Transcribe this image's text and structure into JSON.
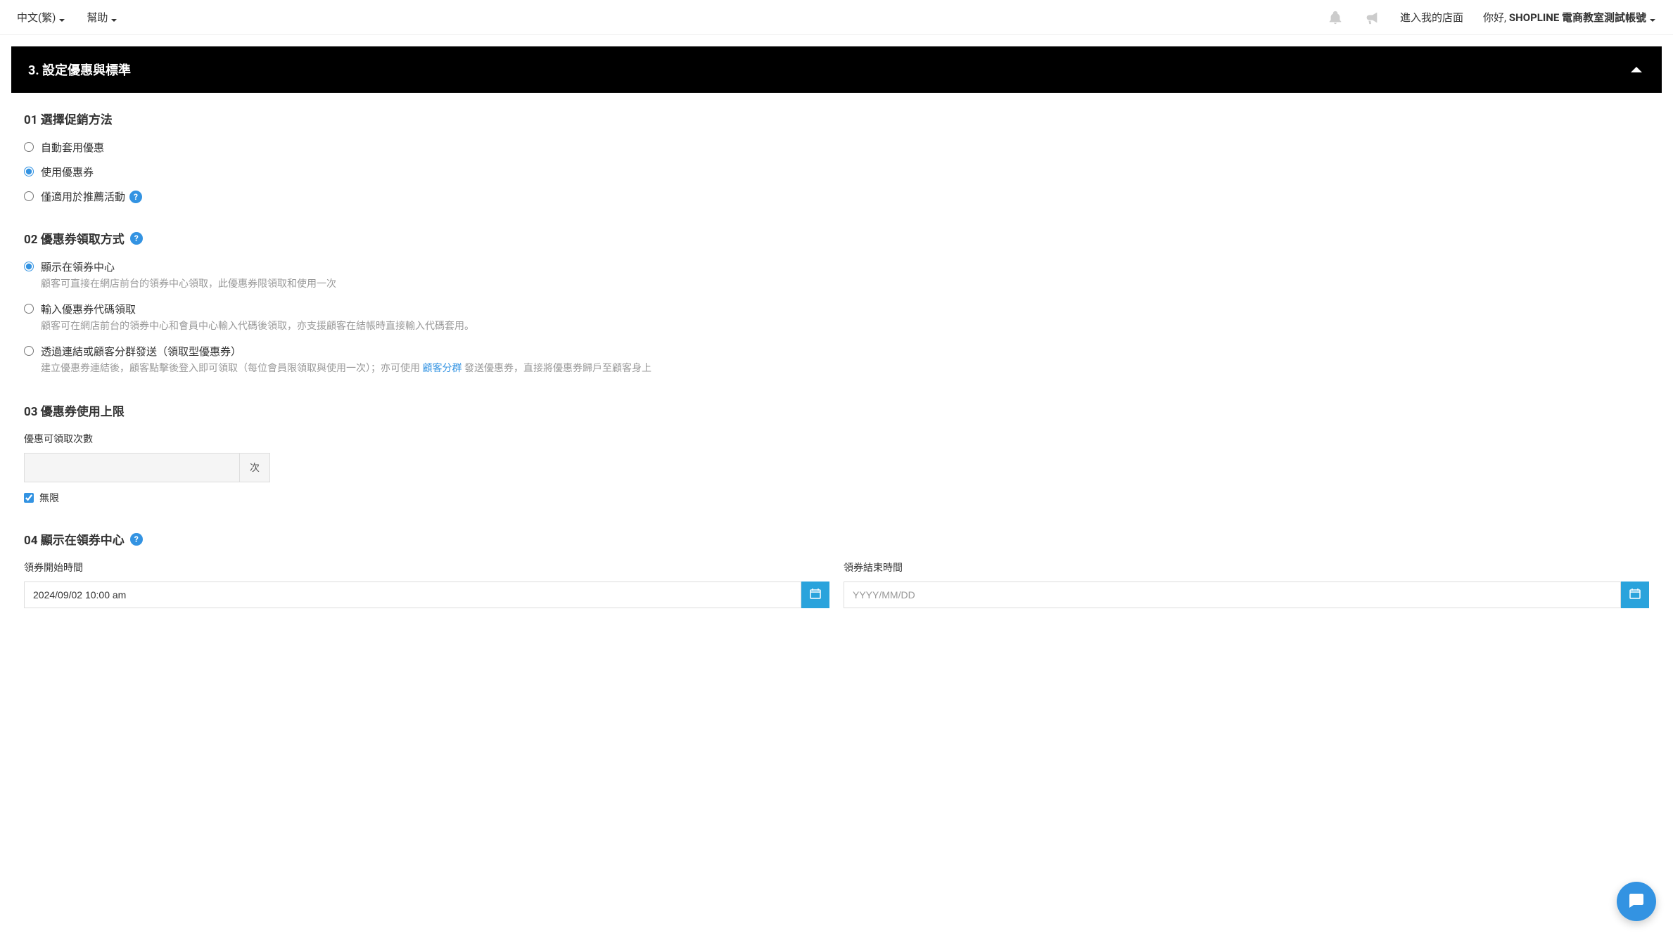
{
  "topbar": {
    "language": "中文(繁)",
    "help": "幫助",
    "enter_store": "進入我的店面",
    "greeting_prefix": "你好, ",
    "greeting_name": "SHOPLINE 電商教室測試帳號"
  },
  "section": {
    "title": "3. 設定優惠與標準"
  },
  "sub01": {
    "title": "01 選擇促銷方法",
    "opt_auto": "自動套用優惠",
    "opt_coupon": "使用優惠券",
    "opt_referral": "僅適用於推薦活動"
  },
  "sub02": {
    "title": "02 優惠券領取方式",
    "opt_center": "顯示在領券中心",
    "opt_center_desc": "顧客可直接在網店前台的領券中心領取，此優惠券限領取和使用一次",
    "opt_code": "輸入優惠券代碼領取",
    "opt_code_desc": "顧客可在網店前台的領券中心和會員中心輸入代碼後領取，亦支援顧客在結帳時直接輸入代碼套用。",
    "opt_link": "透過連結或顧客分群發送（領取型優惠券）",
    "opt_link_desc_pre": "建立優惠券連結後，顧客點擊後登入即可領取（每位會員限領取與使用一次）；亦可使用 ",
    "opt_link_desc_link": "顧客分群",
    "opt_link_desc_post": " 發送優惠券，直接將優惠券歸戶至顧客身上"
  },
  "sub03": {
    "title": "03 優惠券使用上限",
    "limit_label": "優惠可領取次數",
    "limit_suffix": "次",
    "unlimited_label": "無限"
  },
  "sub04": {
    "title": "04 顯示在領券中心",
    "start_label": "領券開始時間",
    "start_value": "2024/09/02 10:00 am",
    "end_label": "領券結束時間",
    "end_placeholder": "YYYY/MM/DD"
  }
}
